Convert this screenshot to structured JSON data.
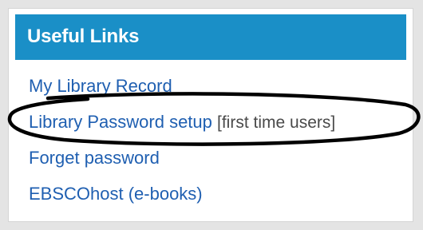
{
  "panel": {
    "title": "Useful Links",
    "header_color": "#1a8fc7",
    "link_color": "#1f5fb1",
    "links": [
      {
        "label": "My Library Record",
        "note": ""
      },
      {
        "label": "Library Password setup",
        "note": "[first time users]"
      },
      {
        "label": "Forget password",
        "note": ""
      },
      {
        "label": "EBSCOhost (e-books)",
        "note": ""
      }
    ]
  },
  "annotation": {
    "type": "hand-drawn ellipse",
    "target": "Library Password setup",
    "color": "#000000"
  }
}
